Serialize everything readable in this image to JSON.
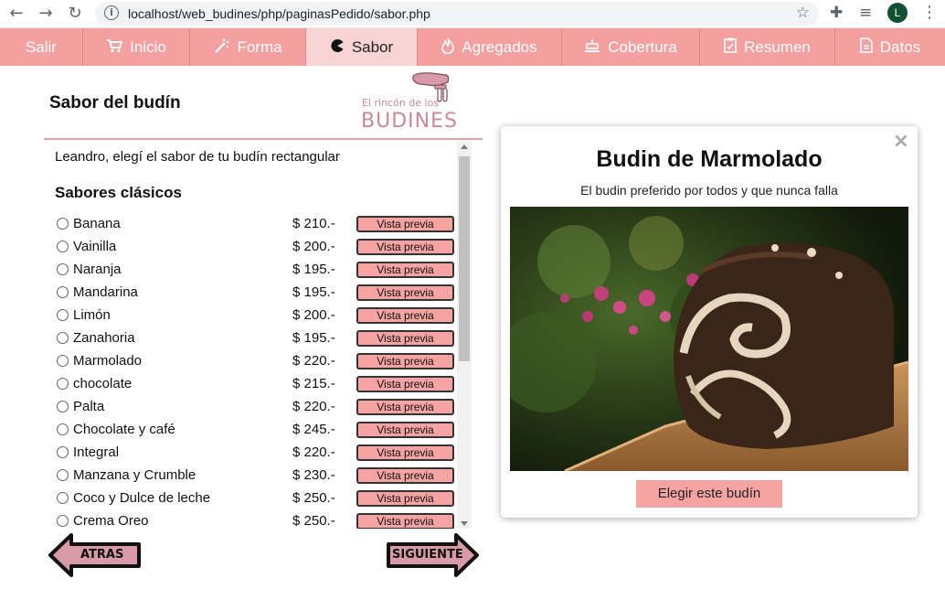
{
  "browser": {
    "url": "localhost/web_budines/php/paginasPedido/sabor.php",
    "avatar_letter": "L"
  },
  "topnav": {
    "items": [
      {
        "label": "Salir",
        "icon": "",
        "active": false
      },
      {
        "label": "Inicio",
        "icon": "cart-icon",
        "active": false
      },
      {
        "label": "Forma",
        "icon": "magic-wand-icon",
        "active": false
      },
      {
        "label": "Sabor",
        "icon": "pacman-icon",
        "active": true
      },
      {
        "label": "Agregados",
        "icon": "fire-icon",
        "active": false
      },
      {
        "label": "Cobertura",
        "icon": "cake-icon",
        "active": false
      },
      {
        "label": "Resumen",
        "icon": "clipboard-check-icon",
        "active": false
      },
      {
        "label": "Datos",
        "icon": "document-icon",
        "active": false
      }
    ]
  },
  "page": {
    "title": "Sabor del budín",
    "logo_line1": "El rincón de los",
    "logo_line2": "BUDINES"
  },
  "list": {
    "intro": "Leandro, elegí el sabor de tu budín rectangular",
    "section_title": "Sabores clásicos",
    "preview_label": "Vista previa",
    "flavors": [
      {
        "name": "Banana",
        "price": "$ 210.-"
      },
      {
        "name": "Vainilla",
        "price": "$ 200.-"
      },
      {
        "name": "Naranja",
        "price": "$ 195.-"
      },
      {
        "name": "Mandarina",
        "price": "$ 195.-"
      },
      {
        "name": "Limón",
        "price": "$ 200.-"
      },
      {
        "name": "Zanahoria",
        "price": "$ 195.-"
      },
      {
        "name": "Marmolado",
        "price": "$ 220.-"
      },
      {
        "name": "chocolate",
        "price": "$ 215.-"
      },
      {
        "name": "Palta",
        "price": "$ 220.-"
      },
      {
        "name": "Chocolate y café",
        "price": "$ 245.-"
      },
      {
        "name": "Integral",
        "price": "$ 220.-"
      },
      {
        "name": "Manzana y Crumble",
        "price": "$ 230.-"
      },
      {
        "name": "Coco y Dulce de leche",
        "price": "$ 250.-"
      },
      {
        "name": "Crema Oreo",
        "price": "$ 250.-"
      }
    ]
  },
  "nav_buttons": {
    "back": "ATRAS",
    "next": "SIGUIENTE"
  },
  "modal": {
    "close": "×",
    "title": "Budin de Marmolado",
    "subtitle": "El budin preferido por todos y que nunca falla",
    "choose_button": "Elegir este budín"
  },
  "colors": {
    "accent": "#f4a0a0",
    "active_tab": "#f8d3d3",
    "preview_button": "#f5a3a3",
    "arrow_fill": "#d99aa7"
  }
}
